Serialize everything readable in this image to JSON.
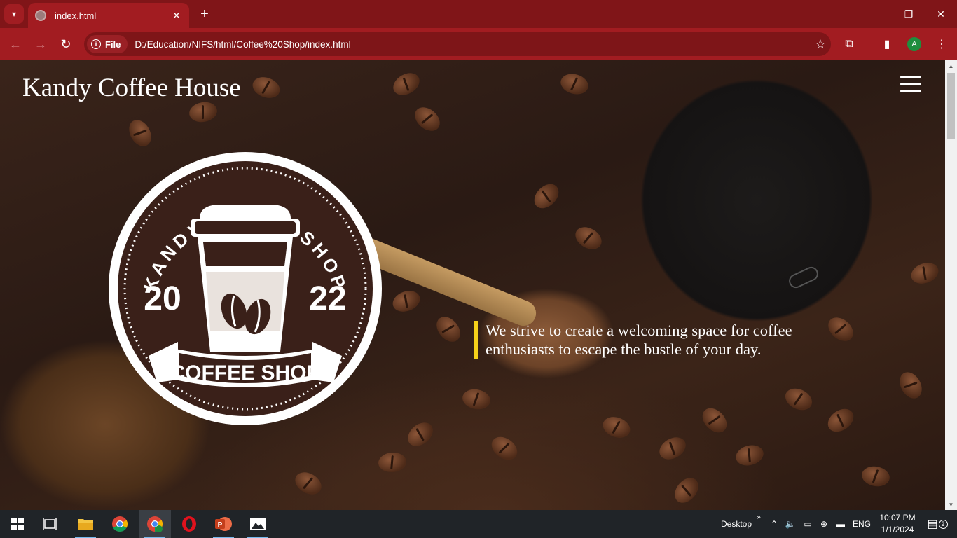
{
  "browser": {
    "tab_title": "index.html",
    "chip_label": "File",
    "url": "D:/Education/NIFS/html/Coffee%20Shop/index.html",
    "profile_initial": "A"
  },
  "site": {
    "title": "Kandy Coffee House",
    "tagline": "We strive to create a welcoming space for coffee enthusiasts to escape the bustle of your day.",
    "accent_color": "#f5d11a",
    "logo": {
      "ring_text": "KANDY COFEE SHOP",
      "year_left": "20",
      "year_right": "22",
      "banner_text": "COFFEE SHOP"
    }
  },
  "taskbar": {
    "desktop_label": "Desktop",
    "language": "ENG",
    "time": "10:07 PM",
    "date": "1/1/2024",
    "notification_count": "2",
    "apps": [
      "windows-start-icon",
      "task-view-icon",
      "file-explorer-icon",
      "chrome-icon",
      "chrome-profile-icon",
      "opera-icon",
      "powerpoint-icon",
      "photos-icon"
    ]
  }
}
